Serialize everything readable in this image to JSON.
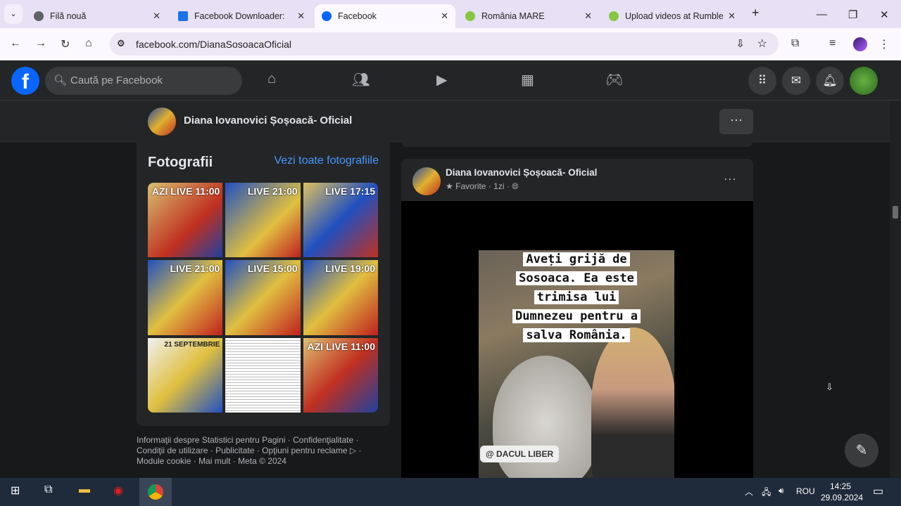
{
  "browser": {
    "tabs": [
      {
        "title": "Filă nouă",
        "color": "#5f6368"
      },
      {
        "title": "Facebook Downloader: D",
        "color": "#1a73e8"
      },
      {
        "title": "Facebook",
        "color": "#0866ff"
      },
      {
        "title": "România MARE",
        "color": "#85c742"
      },
      {
        "title": "Upload videos at Rumble",
        "color": "#85c742"
      }
    ],
    "url": "facebook.com/DianaSosoacaOficial"
  },
  "fb": {
    "search_placeholder": "Caută pe Facebook",
    "page_name": "Diana Iovanovici Șoșoacă- Oficial",
    "photos": {
      "title": "Fotografii",
      "link": "Vezi toate fotografiile",
      "tiles": [
        "AZI LIVE 11:00",
        "LIVE 21:00",
        "LIVE 17:15",
        "LIVE 21:00",
        "LIVE 15:00",
        "LIVE 19:00",
        "21 SEPTEMBRIE",
        "",
        "AZI LIVE 11:00"
      ]
    },
    "footer": [
      "Informaţii despre Statistici pentru Pagini",
      "Confidenţialitate",
      "Condiţii de utilizare",
      "Publicitate",
      "Opţiuni pentru reclame",
      "Module cookie",
      "Mai mult",
      "Meta © 2024"
    ],
    "post": {
      "author": "Diana Iovanovici Șoșoacă- Oficial",
      "favorite": "Favorite",
      "time": "1zi",
      "caption_lines": [
        "Aveți grijă de",
        "Sosoaca. Ea este",
        "trimisa lui",
        "Dumnezeu pentru a",
        "salva România."
      ],
      "watermark": "@ DACUL LIBER"
    }
  },
  "taskbar": {
    "lang": "ROU",
    "time": "14:25",
    "date": "29.09.2024"
  }
}
